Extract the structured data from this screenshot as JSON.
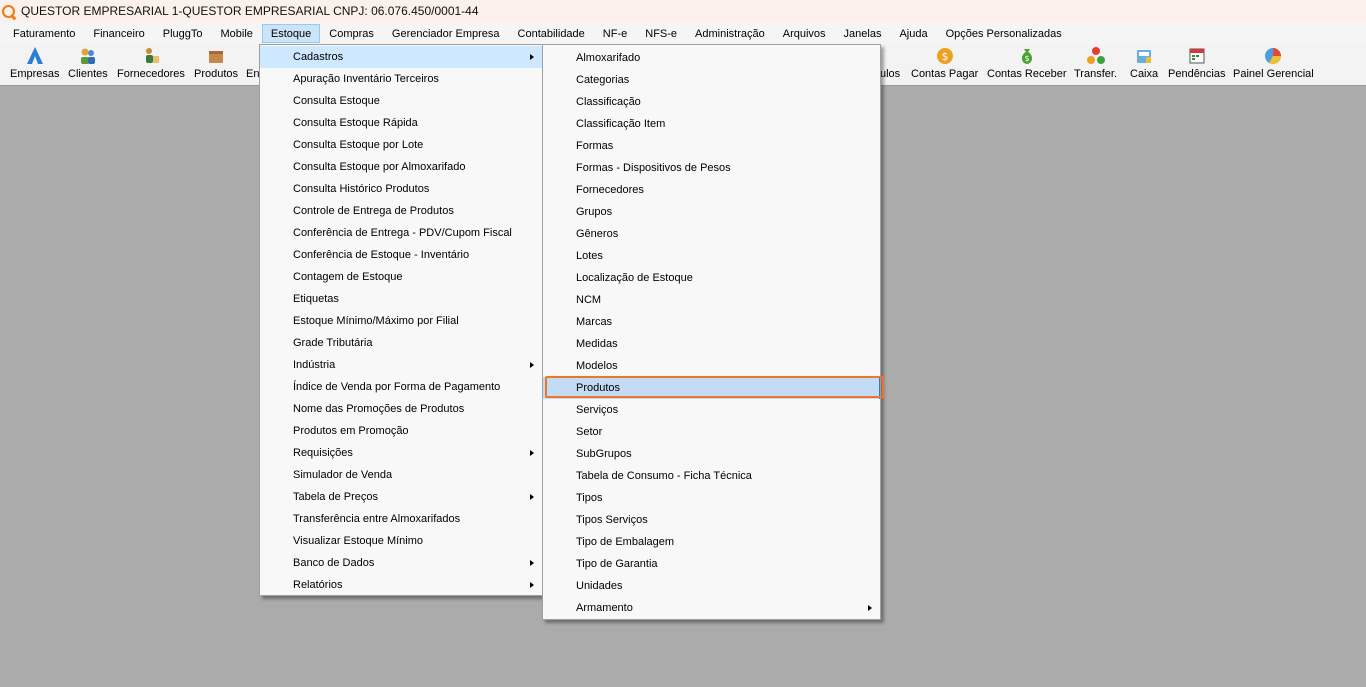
{
  "window": {
    "title": "QUESTOR EMPRESARIAL 1-QUESTOR EMPRESARIAL CNPJ: 06.076.450/0001-44",
    "accent_color": "#f07a16"
  },
  "menubar": [
    {
      "label": "Faturamento"
    },
    {
      "label": "Financeiro"
    },
    {
      "label": "PluggTo"
    },
    {
      "label": "Mobile"
    },
    {
      "label": "Estoque",
      "active": true
    },
    {
      "label": "Compras"
    },
    {
      "label": "Gerenciador Empresa"
    },
    {
      "label": "Contabilidade"
    },
    {
      "label": "NF-e"
    },
    {
      "label": "NFS-e"
    },
    {
      "label": "Administração"
    },
    {
      "label": "Arquivos"
    },
    {
      "label": "Janelas"
    },
    {
      "label": "Ajuda"
    },
    {
      "label": "Opções Personalizadas"
    }
  ],
  "toolbar": {
    "empresas": "Empresas",
    "clientes": "Clientes",
    "fornecedores": "Fornecedores",
    "produtos": "Produtos",
    "cut_left": "En",
    "cut_right": "ulos",
    "contas_pagar": "Contas Pagar",
    "contas_receber": "Contas Receber",
    "transfer": "Transfer.",
    "caixa": "Caixa",
    "pendencias": "Pendências",
    "painel": "Painel Gerencial"
  },
  "estoque_menu": [
    {
      "label": "Cadastros",
      "submenu": true,
      "hover": true
    },
    {
      "label": "Apuração Inventário Terceiros"
    },
    {
      "label": "Consulta Estoque"
    },
    {
      "label": "Consulta Estoque Rápida"
    },
    {
      "label": "Consulta Estoque por Lote"
    },
    {
      "label": "Consulta Estoque por Almoxarifado"
    },
    {
      "label": "Consulta Histórico Produtos"
    },
    {
      "label": "Controle de Entrega de Produtos"
    },
    {
      "label": "Conferência de Entrega - PDV/Cupom Fiscal"
    },
    {
      "label": "Conferência de Estoque - Inventário"
    },
    {
      "label": "Contagem de Estoque"
    },
    {
      "label": "Etiquetas"
    },
    {
      "label": "Estoque Mínimo/Máximo por Filial"
    },
    {
      "label": "Grade Tributária"
    },
    {
      "label": "Indústria",
      "submenu": true
    },
    {
      "label": "Índice de Venda por Forma de Pagamento"
    },
    {
      "label": "Nome das Promoções de Produtos"
    },
    {
      "label": "Produtos em Promoção"
    },
    {
      "label": "Requisições",
      "submenu": true
    },
    {
      "label": "Simulador de Venda"
    },
    {
      "label": "Tabela de Preços",
      "submenu": true
    },
    {
      "label": "Transferência entre Almoxarifados"
    },
    {
      "label": "Visualizar Estoque Mínimo"
    },
    {
      "label": "Banco de Dados",
      "submenu": true
    },
    {
      "label": "Relatórios",
      "submenu": true
    }
  ],
  "cadastros_menu": [
    {
      "label": "Almoxarifado"
    },
    {
      "label": "Categorias"
    },
    {
      "label": "Classificação"
    },
    {
      "label": "Classificação Item"
    },
    {
      "label": "Formas"
    },
    {
      "label": "Formas - Dispositivos de Pesos"
    },
    {
      "label": "Fornecedores"
    },
    {
      "label": "Grupos"
    },
    {
      "label": "Gêneros"
    },
    {
      "label": "Lotes"
    },
    {
      "label": "Localização de Estoque"
    },
    {
      "label": "NCM"
    },
    {
      "label": "Marcas"
    },
    {
      "label": "Medidas"
    },
    {
      "label": "Modelos"
    },
    {
      "label": "Produtos",
      "selected": true
    },
    {
      "label": "Serviços"
    },
    {
      "label": "Setor"
    },
    {
      "label": "SubGrupos"
    },
    {
      "label": "Tabela de Consumo - Ficha Técnica"
    },
    {
      "label": "Tipos"
    },
    {
      "label": "Tipos Serviços"
    },
    {
      "label": "Tipo de Embalagem"
    },
    {
      "label": "Tipo de Garantia"
    },
    {
      "label": "Unidades"
    },
    {
      "label": "Armamento",
      "submenu": true
    }
  ]
}
